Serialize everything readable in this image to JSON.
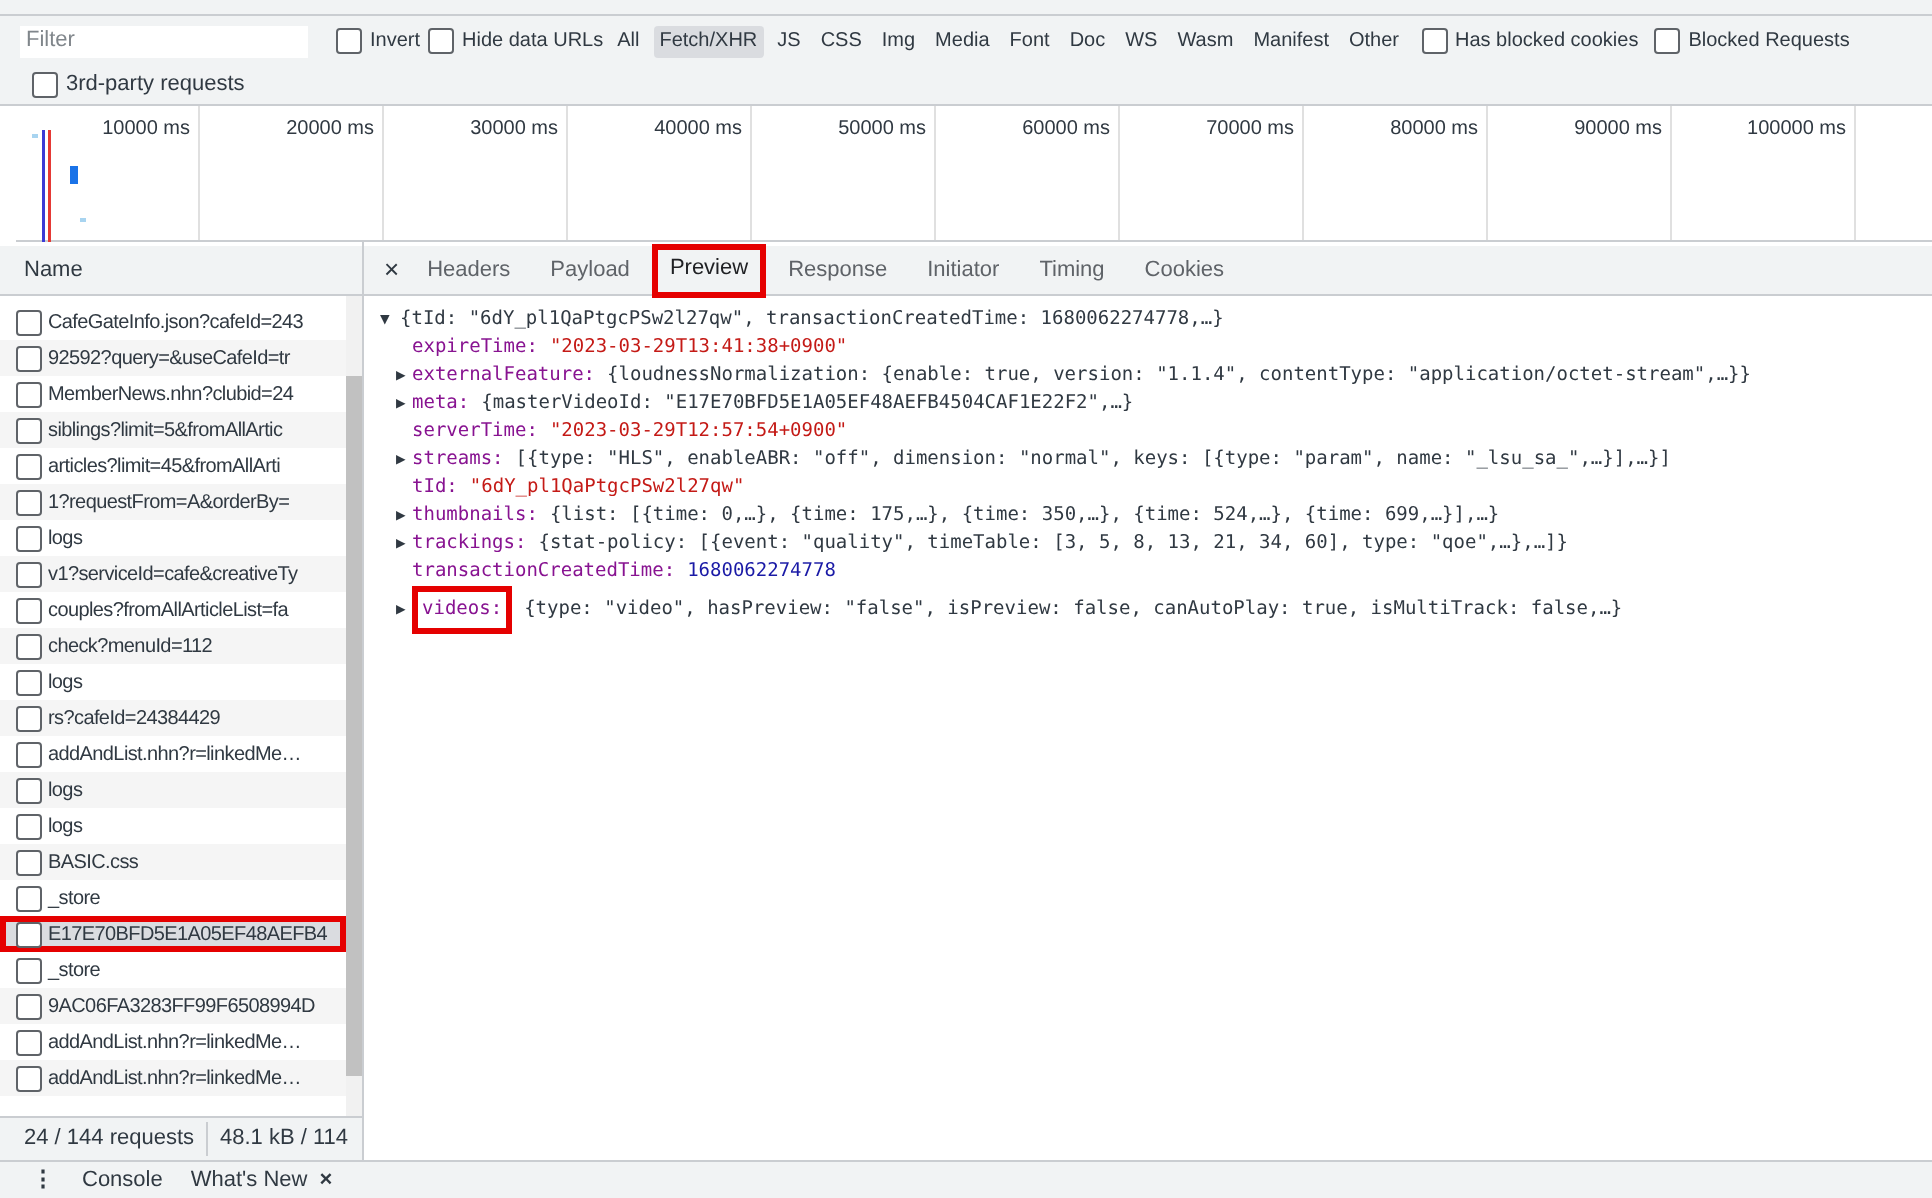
{
  "filter_bar": {
    "placeholder": "Filter",
    "checkboxes": [
      {
        "label": "Invert",
        "checked": false
      },
      {
        "label": "Hide data URLs",
        "checked": false
      }
    ],
    "types": [
      {
        "label": "All",
        "selected": false
      },
      {
        "label": "Fetch/XHR",
        "selected": true
      },
      {
        "label": "JS",
        "selected": false
      },
      {
        "label": "CSS",
        "selected": false
      },
      {
        "label": "Img",
        "selected": false
      },
      {
        "label": "Media",
        "selected": false
      },
      {
        "label": "Font",
        "selected": false
      },
      {
        "label": "Doc",
        "selected": false
      },
      {
        "label": "WS",
        "selected": false
      },
      {
        "label": "Wasm",
        "selected": false
      },
      {
        "label": "Manifest",
        "selected": false
      },
      {
        "label": "Other",
        "selected": false
      }
    ],
    "extra_checkboxes": [
      {
        "label": "Has blocked cookies",
        "checked": false
      },
      {
        "label": "Blocked Requests",
        "checked": false
      },
      {
        "label": "3rd-party requests",
        "checked": false
      }
    ]
  },
  "timeline": {
    "ticks": [
      "10000 ms",
      "20000 ms",
      "30000 ms",
      "40000 ms",
      "50000 ms",
      "60000 ms",
      "70000 ms",
      "80000 ms",
      "90000 ms",
      "100000 ms"
    ]
  },
  "request_list": {
    "header": "Name",
    "rows": [
      {
        "name": "CafeGateInfo.json?cafeId=243",
        "selected": false
      },
      {
        "name": "92592?query=&useCafeId=tr",
        "selected": false
      },
      {
        "name": "MemberNews.nhn?clubid=24",
        "selected": false
      },
      {
        "name": "siblings?limit=5&fromAllArtic",
        "selected": false
      },
      {
        "name": "articles?limit=45&fromAllArti",
        "selected": false
      },
      {
        "name": "1?requestFrom=A&orderBy=",
        "selected": false
      },
      {
        "name": "logs",
        "selected": false
      },
      {
        "name": "v1?serviceId=cafe&creativeTy",
        "selected": false
      },
      {
        "name": "couples?fromAllArticleList=fa",
        "selected": false
      },
      {
        "name": "check?menuId=112",
        "selected": false
      },
      {
        "name": "logs",
        "selected": false
      },
      {
        "name": "rs?cafeId=24384429",
        "selected": false
      },
      {
        "name": "addAndList.nhn?r=linkedMe…",
        "selected": false
      },
      {
        "name": "logs",
        "selected": false
      },
      {
        "name": "logs",
        "selected": false
      },
      {
        "name": "BASIC.css",
        "selected": false
      },
      {
        "name": "_store",
        "selected": false
      },
      {
        "name": "E17E70BFD5E1A05EF48AEFB4",
        "selected": true
      },
      {
        "name": "_store",
        "selected": false
      },
      {
        "name": "9AC06FA3283FF99F6508994D",
        "selected": false
      },
      {
        "name": "addAndList.nhn?r=linkedMe…",
        "selected": false
      },
      {
        "name": "addAndList.nhn?r=linkedMe…",
        "selected": false
      }
    ],
    "status": [
      "24 / 144 requests",
      "48.1 kB / 114"
    ]
  },
  "detail_tabs": {
    "close": "×",
    "tabs": [
      {
        "label": "Headers",
        "selected": false
      },
      {
        "label": "Payload",
        "selected": false
      },
      {
        "label": "Preview",
        "selected": true
      },
      {
        "label": "Response",
        "selected": false
      },
      {
        "label": "Initiator",
        "selected": false
      },
      {
        "label": "Timing",
        "selected": false
      },
      {
        "label": "Cookies",
        "selected": false
      }
    ]
  },
  "preview": {
    "glyphs": {
      "expanded": "▼",
      "collapsed": "▶"
    },
    "separator": ":",
    "summary": "{tId: \"6dY_pl1QaPtgcPSw2l27qw\", transactionCreatedTime: 1680062274778,…}",
    "expanded": true,
    "lines": [
      {
        "key": "expireTime",
        "value": "\"2023-03-29T13:41:38+0900\"",
        "kind": "string",
        "expandable": false
      },
      {
        "key": "externalFeature",
        "value": "{loudnessNormalization: {enable: true, version: \"1.1.4\", contentType: \"application/octet-stream\",…}}",
        "kind": "object",
        "expandable": true
      },
      {
        "key": "meta",
        "value": "{masterVideoId: \"E17E70BFD5E1A05EF48AEFB4504CAF1E22F2\",…}",
        "kind": "object",
        "expandable": true
      },
      {
        "key": "serverTime",
        "value": "\"2023-03-29T12:57:54+0900\"",
        "kind": "string",
        "expandable": false
      },
      {
        "key": "streams",
        "value": "[{type: \"HLS\", enableABR: \"off\", dimension: \"normal\", keys: [{type: \"param\", name: \"_lsu_sa_\",…}],…}]",
        "kind": "object",
        "expandable": true
      },
      {
        "key": "tId",
        "value": "\"6dY_pl1QaPtgcPSw2l27qw\"",
        "kind": "string",
        "expandable": false
      },
      {
        "key": "thumbnails",
        "value": "{list: [{time: 0,…}, {time: 175,…}, {time: 350,…}, {time: 524,…}, {time: 699,…}],…}",
        "kind": "object",
        "expandable": true
      },
      {
        "key": "trackings",
        "value": "{stat-policy: [{event: \"quality\", timeTable: [3, 5, 8, 13, 21, 34, 60], type: \"qoe\",…},…]}",
        "kind": "object",
        "expandable": true
      },
      {
        "key": "transactionCreatedTime",
        "value": "1680062274778",
        "kind": "number",
        "expandable": false
      },
      {
        "key": "videos",
        "value": "{type: \"video\", hasPreview: \"false\", isPreview: false, canAutoPlay: true, isMultiTrack: false,…}",
        "kind": "object",
        "expandable": true,
        "highlighted": true
      }
    ]
  },
  "drawer": {
    "menu": "⋮",
    "tabs": [
      {
        "label": "Console"
      },
      {
        "label": "What's New",
        "close": "×"
      }
    ]
  }
}
